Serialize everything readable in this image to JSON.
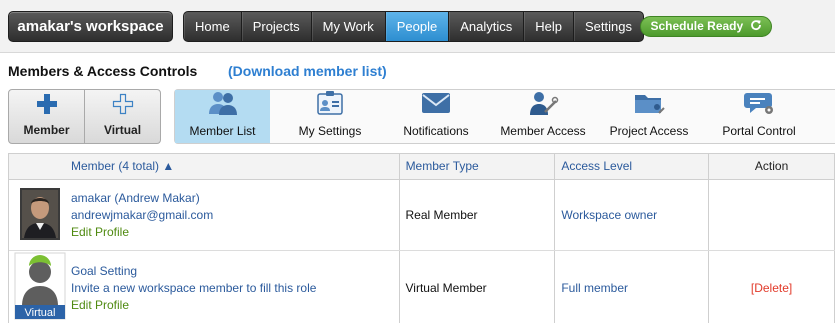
{
  "topbar": {
    "workspace_title": "amakar's workspace",
    "nav": [
      {
        "label": "Home"
      },
      {
        "label": "Projects"
      },
      {
        "label": "My Work"
      },
      {
        "label": "People"
      },
      {
        "label": "Analytics"
      },
      {
        "label": "Help"
      },
      {
        "label": "Settings"
      }
    ],
    "active_nav": "People",
    "schedule_status": "Schedule Ready",
    "schedule_icon": "refresh-icon"
  },
  "page": {
    "title": "Members & Access Controls",
    "download_link": "(Download member list)"
  },
  "add_buttons": [
    {
      "label": "Member",
      "icon": "plus-solid-icon"
    },
    {
      "label": "Virtual",
      "icon": "plus-outline-icon"
    }
  ],
  "tabs": [
    {
      "label": "Member List",
      "icon": "people-icon"
    },
    {
      "label": "My Settings",
      "icon": "id-card-icon"
    },
    {
      "label": "Notifications",
      "icon": "envelope-icon"
    },
    {
      "label": "Member Access",
      "icon": "user-key-icon"
    },
    {
      "label": "Project Access",
      "icon": "folder-user-icon"
    },
    {
      "label": "Portal Control",
      "icon": "chat-gear-icon"
    }
  ],
  "active_tab": "Member List",
  "table": {
    "headers": {
      "member": "Member (4 total) ▲",
      "type": "Member Type",
      "access": "Access Level",
      "action": "Action"
    },
    "rows": [
      {
        "name": "amakar (Andrew Makar)",
        "subline": "andrewjmakar@gmail.com",
        "edit": "Edit Profile",
        "type": "Real Member",
        "access": "Workspace owner",
        "action": ""
      },
      {
        "name": "Goal Setting",
        "subline": "Invite a new workspace member to fill this role",
        "edit": "Edit Profile",
        "type": "Virtual Member",
        "access": "Full member",
        "action": "[Delete]",
        "avatar_badge": "Virtual"
      }
    ]
  },
  "colors": {
    "nav_active": "#2d8ed0",
    "link_blue": "#2e7fd1",
    "schedule_green": "#5aa634",
    "tab_active_bg": "#b4dcf2",
    "delete_red": "#e23a2a",
    "edit_green": "#4f8a10"
  }
}
